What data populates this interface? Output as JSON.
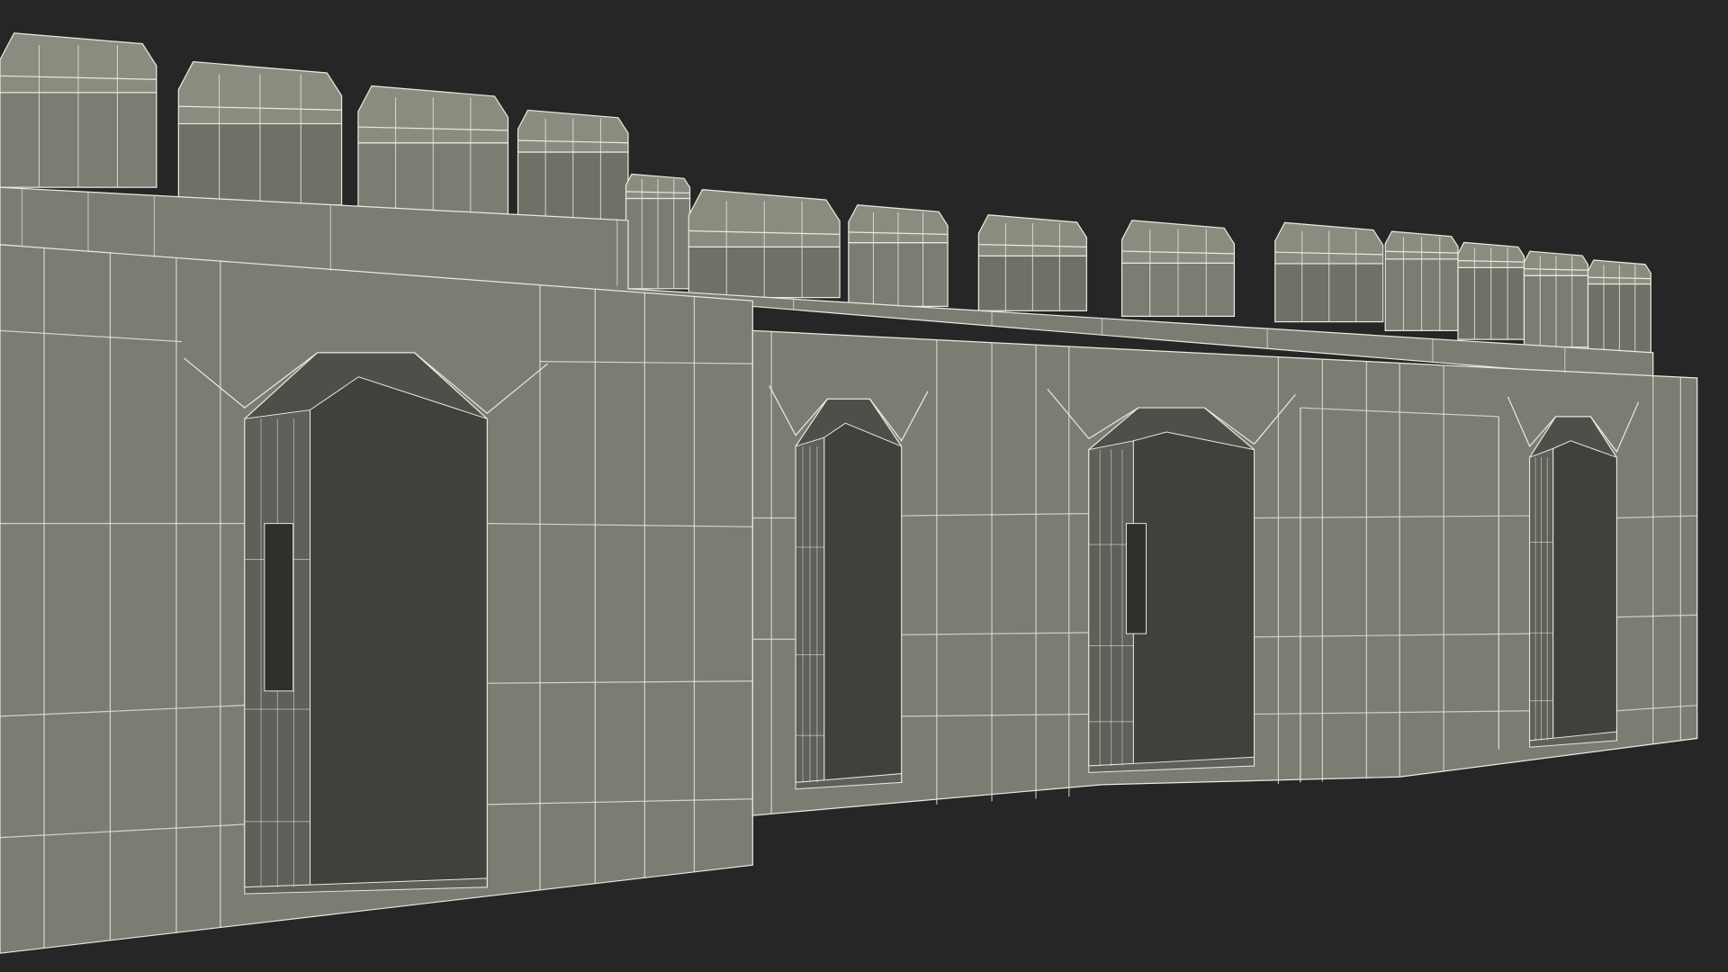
{
  "scene": {
    "subject": "castle-wall-wireframe",
    "colors": {
      "background": "#262626",
      "wall_face": "#7b7d72",
      "wall_shade": "#6f7167",
      "recess": "#4d4f49",
      "recess_dark": "#3f413c",
      "recess_side": "#5e6059",
      "top_face": "#8a8c80",
      "wire": "#e9eadf"
    },
    "counts": {
      "merlons": 14,
      "arched_niches": 4,
      "arrow_slits": 2
    }
  }
}
